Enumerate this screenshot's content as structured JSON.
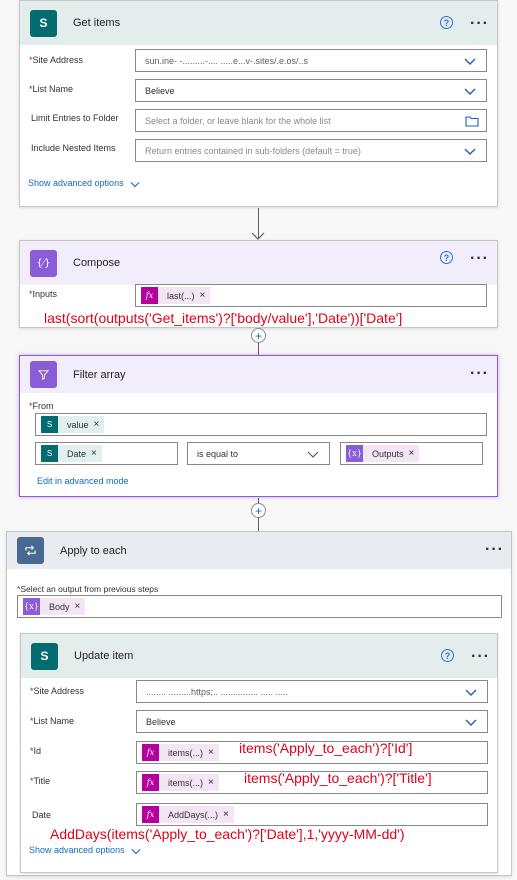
{
  "get_items": {
    "title": "Get items",
    "site_address_label": "Site Address",
    "site_address_value": "sun.ine- -.........-.... .....e...v-.sites/.e.os/..s",
    "list_name_label": "List Name",
    "list_name_value": "Believe",
    "limit_entries_label": "Limit Entries to Folder",
    "limit_entries_placeholder": "Select a folder, or leave blank for the whole list",
    "nested_items_label": "Include Nested Items",
    "nested_items_placeholder": "Return entries contained in sub-folders (default = true)",
    "advanced_link": "Show advanced options"
  },
  "compose": {
    "title": "Compose",
    "inputs_label": "Inputs",
    "token_label": "last(...)",
    "annotation": "last(sort(outputs('Get_items')?['body/value'],'Date'))['Date']"
  },
  "filter_array": {
    "title": "Filter array",
    "from_label": "From",
    "from_token": "value",
    "left_token": "Date",
    "operator": "is equal to",
    "right_token": "Outputs",
    "advanced_link": "Edit in advanced mode"
  },
  "apply_to_each": {
    "title": "Apply to each",
    "select_label": "Select an output from previous steps",
    "body_token": "Body"
  },
  "update_item": {
    "title": "Update item",
    "site_address_label": "Site Address",
    "site_address_value": "........ .........https;.. ............... .....  .....",
    "list_name_label": "List Name",
    "list_name_value": "Believe",
    "id_label": "Id",
    "id_token": "items(...)",
    "id_annotation": "items('Apply_to_each')?['Id']",
    "title_label": "Title",
    "title_token": "items(...)",
    "title_annotation": "items('Apply_to_each')?['Title']",
    "date_label": "Date",
    "date_token": "AddDays(...)",
    "date_annotation": "AddDays(items('Apply_to_each')?['Date'],1,'yyyy-MM-dd')",
    "advanced_link": "Show advanced options"
  },
  "symbols": {
    "required": "*",
    "help": "?",
    "more": "···",
    "remove": "×",
    "plus": "+",
    "fx": "fx",
    "sp": "S",
    "braces": "{⁄}",
    "expr": "{x}"
  },
  "colors": {
    "sharepoint": "#036c70",
    "compose": "#8a5cd6",
    "expression": "#b4009e",
    "loop": "#486991",
    "link": "#0f6cbd",
    "annotation": "#e0001b"
  },
  "icons": [
    "sharepoint-icon",
    "compose-icon",
    "filter-icon",
    "loop-icon",
    "chevron-down-icon",
    "folder-icon",
    "help-icon",
    "more-icon",
    "plus-icon",
    "arrow-down-icon"
  ]
}
